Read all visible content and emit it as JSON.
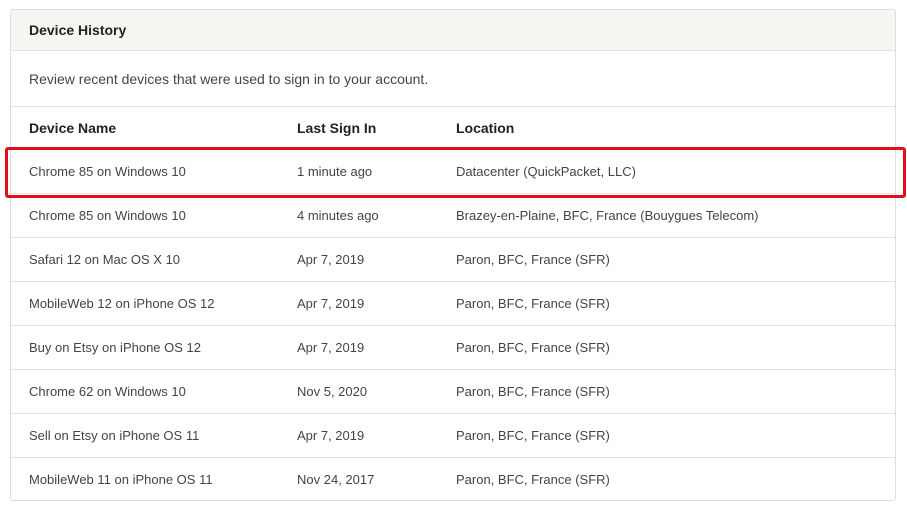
{
  "panel": {
    "title": "Device History",
    "description": "Review recent devices that were used to sign in to your account."
  },
  "table": {
    "columns": [
      "Device Name",
      "Last Sign In",
      "Location"
    ],
    "rows": [
      {
        "device": "Chrome 85 on Windows 10",
        "last_sign_in": "1 minute ago",
        "location": "Datacenter (QuickPacket, LLC)"
      },
      {
        "device": "Chrome 85 on Windows 10",
        "last_sign_in": "4 minutes ago",
        "location": "Brazey-en-Plaine, BFC, France (Bouygues Telecom)"
      },
      {
        "device": "Safari 12 on Mac OS X 10",
        "last_sign_in": "Apr 7, 2019",
        "location": "Paron, BFC, France (SFR)"
      },
      {
        "device": "MobileWeb 12 on iPhone OS 12",
        "last_sign_in": "Apr 7, 2019",
        "location": "Paron, BFC, France (SFR)"
      },
      {
        "device": "Buy on Etsy on iPhone OS 12",
        "last_sign_in": "Apr 7, 2019",
        "location": "Paron, BFC, France (SFR)"
      },
      {
        "device": "Chrome 62 on Windows 10",
        "last_sign_in": "Nov 5, 2020",
        "location": "Paron, BFC, France (SFR)"
      },
      {
        "device": "Sell on Etsy on iPhone OS 11",
        "last_sign_in": "Apr 7, 2019",
        "location": "Paron, BFC, France (SFR)"
      },
      {
        "device": "MobileWeb 11 on iPhone OS 11",
        "last_sign_in": "Nov 24, 2017",
        "location": "Paron, BFC, France (SFR)"
      }
    ]
  },
  "highlight": {
    "color": "#e0101a",
    "row_index": 0
  }
}
